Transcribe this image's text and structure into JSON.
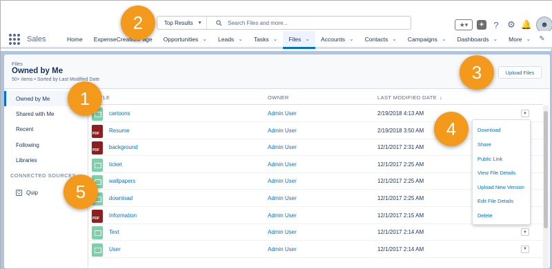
{
  "header": {
    "search_scope": "Top Results",
    "search_placeholder": "Search Files and more...",
    "icons": [
      "favorites-star-icon",
      "add-icon",
      "help-icon",
      "setup-gear-icon",
      "notifications-bell-icon",
      "user-avatar"
    ]
  },
  "nav": {
    "app_name": "Sales",
    "items": [
      {
        "label": "Home",
        "chevron": false
      },
      {
        "label": "ExpenseCreationPage",
        "chevron": false
      },
      {
        "label": "Opportunities",
        "chevron": true
      },
      {
        "label": "Leads",
        "chevron": true
      },
      {
        "label": "Tasks",
        "chevron": true
      },
      {
        "label": "Files",
        "chevron": true,
        "active": true
      },
      {
        "label": "Accounts",
        "chevron": true
      },
      {
        "label": "Contacts",
        "chevron": true
      },
      {
        "label": "Campaigns",
        "chevron": true
      },
      {
        "label": "Dashboards",
        "chevron": true
      },
      {
        "label": "More",
        "chevron": true
      }
    ]
  },
  "page_header": {
    "eyebrow": "Files",
    "title": "Owned by Me",
    "meta": "50+ items • Sorted by Last Modified Date",
    "upload_button": "Upload Files"
  },
  "sidebar": {
    "items": [
      "Owned by Me",
      "Shared with Me",
      "Recent",
      "Following",
      "Libraries"
    ],
    "section_heading": "CONNECTED SOURCES",
    "sources": [
      "Quip"
    ]
  },
  "table": {
    "columns": [
      "TITLE",
      "OWNER",
      "LAST MODIFIED DATE"
    ],
    "sort_indicator": "↓",
    "rows": [
      {
        "icon": "image",
        "name": "cartoons",
        "owner": "Admin User",
        "date": "2/19/2018 4:13 AM",
        "action": true
      },
      {
        "icon": "pdf",
        "name": "Resume",
        "owner": "Admin User",
        "date": "2/19/2018 3:50 AM",
        "action": false
      },
      {
        "icon": "pdf",
        "name": "background",
        "owner": "Admin User",
        "date": "12/1/2017 2:31 AM",
        "action": false
      },
      {
        "icon": "image",
        "name": "ticket",
        "owner": "Admin User",
        "date": "12/1/2017 2:25 AM",
        "action": false
      },
      {
        "icon": "image",
        "name": "wallpapers",
        "owner": "Admin User",
        "date": "12/1/2017 2:25 AM",
        "action": false
      },
      {
        "icon": "image",
        "name": "download",
        "owner": "Admin User",
        "date": "12/1/2017 2:25 AM",
        "action": false
      },
      {
        "icon": "pdf",
        "name": "Information",
        "owner": "Admin User",
        "date": "12/1/2017 2:15 AM",
        "action": false
      },
      {
        "icon": "image",
        "name": "Text",
        "owner": "Admin User",
        "date": "12/1/2017 2:14 AM",
        "action": true
      },
      {
        "icon": "image",
        "name": "User",
        "owner": "Admin User",
        "date": "12/1/2017 2:14 AM",
        "action": true
      }
    ]
  },
  "row_menu": {
    "items": [
      "Download",
      "Share",
      "Public Link",
      "View File Details",
      "Upload New Version",
      "Edit File Details",
      "Delete"
    ]
  },
  "callouts": [
    "1",
    "2",
    "3",
    "4",
    "5"
  ],
  "colors": {
    "accent": "#0070d2",
    "callout": "#f39a1c",
    "page_bg": "#b0c4df",
    "pdf_icon": "#8d1f1f",
    "image_icon": "#7ed0a8"
  }
}
